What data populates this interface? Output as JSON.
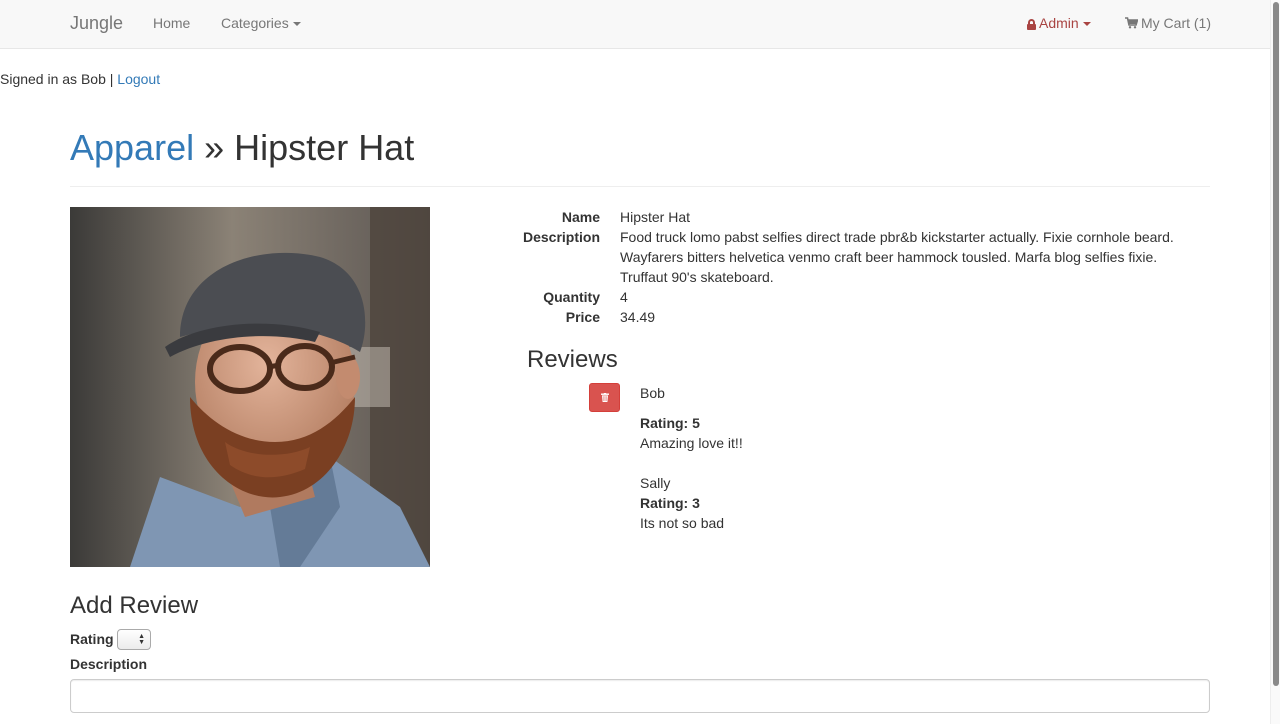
{
  "navbar": {
    "brand": "Jungle",
    "home": "Home",
    "categories": "Categories",
    "admin": "Admin",
    "cart": "My Cart (1)",
    "lock_icon": "lock-icon",
    "cart_icon": "shopping-cart-icon"
  },
  "session": {
    "signed_in_text": "Signed in as Bob |",
    "logout": "Logout"
  },
  "breadcrumb": {
    "category": "Apparel",
    "separator": "»",
    "product": "Hipster Hat"
  },
  "product": {
    "image_alt": "Hipster Hat product photo",
    "fields": [
      {
        "label": "Name",
        "value": "Hipster Hat"
      },
      {
        "label": "Description",
        "value": "Food truck lomo pabst selfies direct trade pbr&b kickstarter actually. Fixie cornhole beard. Wayfarers bitters helvetica venmo craft beer hammock tousled. Marfa blog selfies fixie. Truffaut 90's skateboard."
      },
      {
        "label": "Quantity",
        "value": "4"
      },
      {
        "label": "Price",
        "value": "34.49"
      }
    ]
  },
  "reviews": {
    "title": "Reviews",
    "delete_icon": "trash-icon",
    "items": [
      {
        "author": "Bob",
        "rating": "Rating: 5",
        "text": "Amazing love it!!"
      },
      {
        "author": "Sally",
        "rating": "Rating: 3",
        "text": "Its not so bad"
      }
    ]
  },
  "add_review": {
    "title": "Add Review",
    "rating_label": "Rating",
    "rating_value": "",
    "description_label": "Description",
    "description_value": ""
  },
  "colors": {
    "link": "#337ab7",
    "admin": "#a94442",
    "danger": "#d9534f"
  }
}
